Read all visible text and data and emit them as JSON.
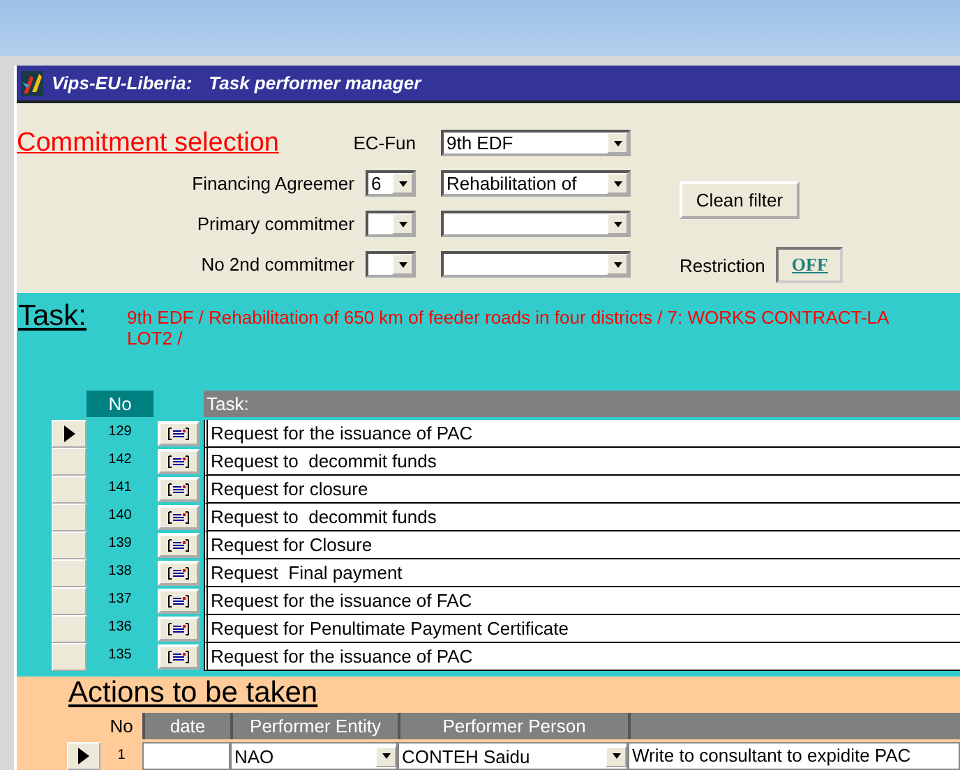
{
  "window": {
    "app": "Vips-EU-Liberia:",
    "title": "Task performer manager"
  },
  "commitment": {
    "heading": "Commitment selection",
    "filters": [
      {
        "kind": "single",
        "label": "EC-Fun",
        "value": "9th EDF"
      },
      {
        "kind": "pair",
        "label": "Financing Agreemer",
        "code": "6",
        "value": "Rehabilitation of"
      },
      {
        "kind": "pair",
        "label": "Primary commitmer"
      },
      {
        "kind": "pair",
        "label": "No 2nd commitmer"
      }
    ],
    "clean_button": "Clean filter",
    "restriction": {
      "label": "Restriction",
      "toggle": "OFF"
    }
  },
  "task": {
    "label": "Task:",
    "path_lines": [
      "9th EDF / Rehabilitation of 650 km of feeder roads in four districts / 7: WORKS CONTRACT-LA",
      "LOT2 /"
    ]
  },
  "tasks": {
    "columns": [
      "No",
      "Task:"
    ],
    "rows": [
      {
        "no": "129",
        "task": "Request for the issuance of PAC",
        "selected": true
      },
      {
        "no": "142",
        "task": "Request to  decommit funds",
        "selected": false
      },
      {
        "no": "141",
        "task": "Request for closure",
        "selected": false
      },
      {
        "no": "140",
        "task": "Request to  decommit funds",
        "selected": false
      },
      {
        "no": "139",
        "task": "Request for Closure",
        "selected": false
      },
      {
        "no": "138",
        "task": "Request  Final payment",
        "selected": false
      },
      {
        "no": "137",
        "task": "Request for the issuance of FAC",
        "selected": false
      },
      {
        "no": "136",
        "task": "Request for Penultimate Payment Certificate",
        "selected": false
      },
      {
        "no": "135",
        "task": "Request for the issuance of PAC",
        "selected": false
      }
    ]
  },
  "actions": {
    "heading": "Actions to be taken",
    "columns": [
      "No",
      "date",
      "Performer Entity",
      "Performer Person"
    ],
    "rows": [
      {
        "no": "1",
        "entity": "NAO",
        "person": "CONTEH Saidu",
        "action": "Write to consultant to expidite PAC",
        "selected": true
      }
    ]
  }
}
